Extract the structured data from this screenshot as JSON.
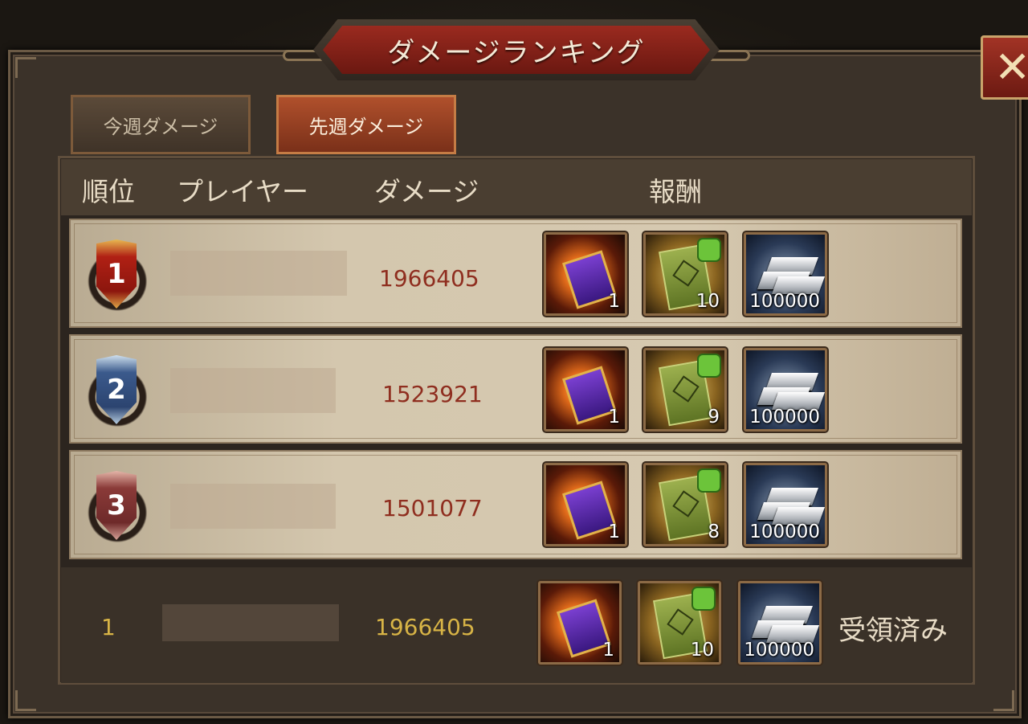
{
  "title": "ダメージランキング",
  "close_icon": "close-x-icon",
  "tabs": [
    {
      "label": "今週ダメージ",
      "active": false
    },
    {
      "label": "先週ダメージ",
      "active": true
    }
  ],
  "columns": {
    "rank": "順位",
    "player": "プレイヤー",
    "damage": "ダメージ",
    "reward": "報酬"
  },
  "rows": [
    {
      "rank": "1",
      "damage": "1966405",
      "rewards": [
        {
          "icon": "purple-token-icon",
          "qty": "1"
        },
        {
          "icon": "general-book-fragment-icon",
          "qty": "10"
        },
        {
          "icon": "silver-ingot-icon",
          "qty": "100000"
        }
      ]
    },
    {
      "rank": "2",
      "damage": "1523921",
      "rewards": [
        {
          "icon": "purple-token-icon",
          "qty": "1"
        },
        {
          "icon": "general-book-fragment-icon",
          "qty": "9"
        },
        {
          "icon": "silver-ingot-icon",
          "qty": "100000"
        }
      ]
    },
    {
      "rank": "3",
      "damage": "1501077",
      "rewards": [
        {
          "icon": "purple-token-icon",
          "qty": "1"
        },
        {
          "icon": "general-book-fragment-icon",
          "qty": "8"
        },
        {
          "icon": "silver-ingot-icon",
          "qty": "100000"
        }
      ]
    }
  ],
  "self": {
    "rank": "1",
    "damage": "1966405",
    "rewards": [
      {
        "icon": "purple-token-icon",
        "qty": "1"
      },
      {
        "icon": "general-book-fragment-icon",
        "qty": "10"
      },
      {
        "icon": "silver-ingot-icon",
        "qty": "100000"
      }
    ],
    "status": "受領済み"
  },
  "colors": {
    "damage_text": "#8f2e1f",
    "self_highlight": "#d8b446",
    "active_tab": "#b0502c"
  }
}
